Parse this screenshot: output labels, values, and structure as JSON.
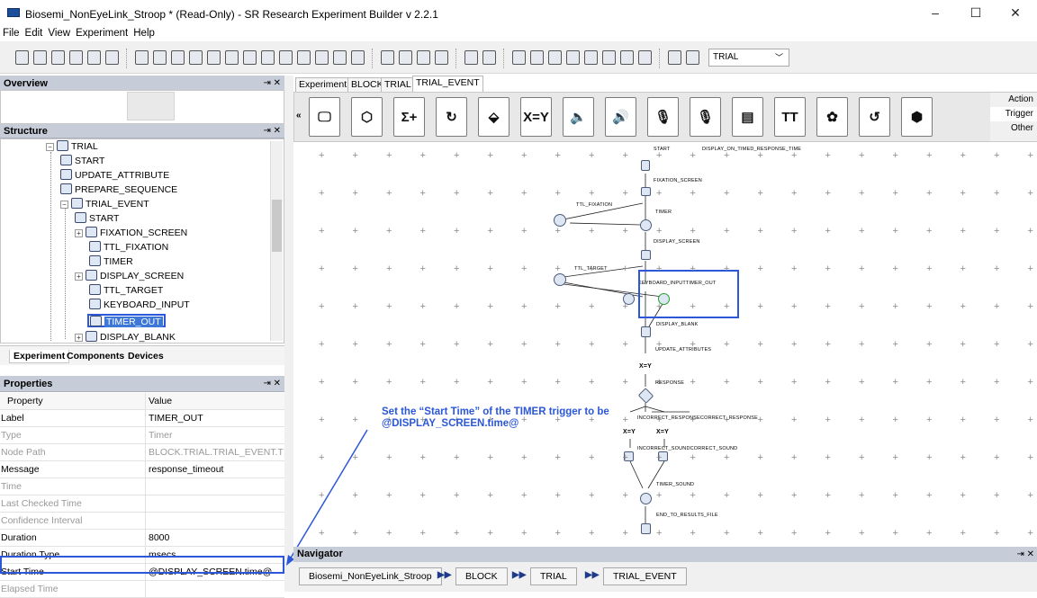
{
  "window": {
    "title": "Biosemi_NonEyeLink_Stroop * (Read-Only) - SR Research Experiment Builder v 2.2.1",
    "controls": [
      "–",
      "☐",
      "✕"
    ]
  },
  "menu": [
    "File",
    "Edit",
    "View",
    "Experiment",
    "Help"
  ],
  "toolbar": {
    "dropdown_value": "TRIAL",
    "icons": [
      "new-icon",
      "open-icon",
      "save-icon",
      "save-as-icon",
      "deploy-icon",
      "package-icon",
      "undo-icon",
      "redo-icon",
      "cut-icon",
      "copy-icon",
      "paste-icon",
      "paste-special-icon",
      "delete-icon",
      "clean-icon",
      "screen-icon",
      "check-icon",
      "build-icon",
      "library-icon",
      "test-run-icon",
      "build-run-icon",
      "run-icon",
      "stop-icon",
      "deploy-run-icon",
      "back-icon",
      "forward-icon",
      "zoom-icon",
      "zoom-in-icon",
      "zoom-out-icon",
      "grid-icon",
      "layout-icon",
      "preferences-icon",
      "new-window-icon",
      "clone-icon"
    ]
  },
  "overview": {
    "title": "Overview"
  },
  "structure": {
    "title": "Structure",
    "items": [
      {
        "label": "TRIAL",
        "icon": "sequence-icon"
      },
      {
        "label": "START",
        "icon": "start-icon"
      },
      {
        "label": "UPDATE_ATTRIBUTE",
        "icon": "update-attribute-icon"
      },
      {
        "label": "PREPARE_SEQUENCE",
        "icon": "prepare-sequence-icon"
      },
      {
        "label": "TRIAL_EVENT",
        "icon": "sequence-icon"
      },
      {
        "label": "START",
        "icon": "start-icon"
      },
      {
        "label": "FIXATION_SCREEN",
        "icon": "display-screen-icon"
      },
      {
        "label": "TTL_FIXATION",
        "icon": "ttl-icon"
      },
      {
        "label": "TIMER",
        "icon": "timer-icon"
      },
      {
        "label": "DISPLAY_SCREEN",
        "icon": "display-screen-icon"
      },
      {
        "label": "TTL_TARGET",
        "icon": "ttl-icon"
      },
      {
        "label": "KEYBOARD_INPUT",
        "icon": "keyboard-icon"
      },
      {
        "label": "TIMER_OUT",
        "icon": "timer-icon"
      },
      {
        "label": "DISPLAY_BLANK",
        "icon": "display-screen-icon"
      }
    ],
    "tabs": [
      "Experiment",
      "Components",
      "Devices"
    ]
  },
  "properties": {
    "title": "Properties",
    "header": {
      "key": "Property",
      "value": "Value"
    },
    "rows": [
      {
        "key": "Label",
        "value": "TIMER_OUT",
        "dim": false
      },
      {
        "key": "Type",
        "value": "Timer",
        "dim": true
      },
      {
        "key": "Node Path",
        "value": "BLOCK.TRIAL.TRIAL_EVENT.TIM...",
        "dim": true
      },
      {
        "key": "Message",
        "value": "response_timeout",
        "dim": false
      },
      {
        "key": "Time",
        "value": "",
        "dim": true
      },
      {
        "key": "Last Checked Time",
        "value": "",
        "dim": true
      },
      {
        "key": "Confidence Interval",
        "value": "",
        "dim": true
      },
      {
        "key": "Duration",
        "value": "8000",
        "dim": false
      },
      {
        "key": "Duration Type",
        "value": "msecs",
        "dim": false
      },
      {
        "key": "Start Time",
        "value": "@DISPLAY_SCREEN.time@",
        "dim": false
      },
      {
        "key": "Elapsed Time",
        "value": "",
        "dim": true
      }
    ]
  },
  "editor": {
    "tabs": [
      "Experiment",
      "BLOCK",
      "TRIAL",
      "TRIAL_EVENT"
    ],
    "palette": [
      {
        "name": "display-screen-icon",
        "glyph": "🖵"
      },
      {
        "name": "drift-correct-icon",
        "glyph": "⬡"
      },
      {
        "name": "accumulator-icon",
        "glyph": "Σ+"
      },
      {
        "name": "prepare-sequence-icon",
        "glyph": "↻"
      },
      {
        "name": "ttl-icon",
        "glyph": "⬙"
      },
      {
        "name": "update-attribute-icon",
        "glyph": "X=Y"
      },
      {
        "name": "play-sound-icon",
        "glyph": "🔈"
      },
      {
        "name": "play-sound-control-icon",
        "glyph": "🔊"
      },
      {
        "name": "record-sound-icon",
        "glyph": "🎙"
      },
      {
        "name": "record-sound-control-icon",
        "glyph": "🎙"
      },
      {
        "name": "results-file-icon",
        "glyph": "▤"
      },
      {
        "name": "text-icon",
        "glyph": "TT"
      },
      {
        "name": "eyelink-icon",
        "glyph": "✿"
      },
      {
        "name": "timer-reset-icon",
        "glyph": "↺"
      },
      {
        "name": "terminate-icon",
        "glyph": "⬢"
      }
    ],
    "palette_side": [
      "Action",
      "Trigger",
      "Other"
    ],
    "flow_labels": {
      "start": "START",
      "display_on_timed": "DISPLAY_ON_TIMED_RESPONSE_TIME",
      "fixation_screen": "FIXATION_SCREEN",
      "ttl_fixation": "TTL_FIXATION",
      "timer": "TIMER",
      "display_screen": "DISPLAY_SCREEN",
      "ttl_target": "TTL_TARGET",
      "keyboard_input_timer_out": "KEYBOARD_INPUTTIMER_OUT",
      "display_blank": "DISPLAY_BLANK",
      "update_attributes": "UPDATE_ATTRIBUTES",
      "response": "RESPONSE",
      "incorrect_response_correct_response": "INCORRECT_RESPONSECORRECT_RESPONSE",
      "incorrect_sound_correct_sound": "INCORRECT_SOUNDCORRECT_SOUND",
      "timer_sound": "TIMER_SOUND",
      "end_to_results_file": "END_TO_RESULTS_FILE",
      "xy1": "X=Y",
      "xy2": "X=Y",
      "xy3": "X=Y"
    },
    "callout": "Set the “Start Time” of the TIMER trigger to be @DISPLAY_SCREEN.time@"
  },
  "navigator": {
    "title": "Navigator",
    "crumbs": [
      "Biosemi_NonEyeLink_Stroop",
      "BLOCK",
      "TRIAL",
      "TRIAL_EVENT"
    ]
  },
  "colors": {
    "accent": "#2b57d8",
    "panel_header": "#c6cdd8",
    "selection": "#3d78d8"
  }
}
